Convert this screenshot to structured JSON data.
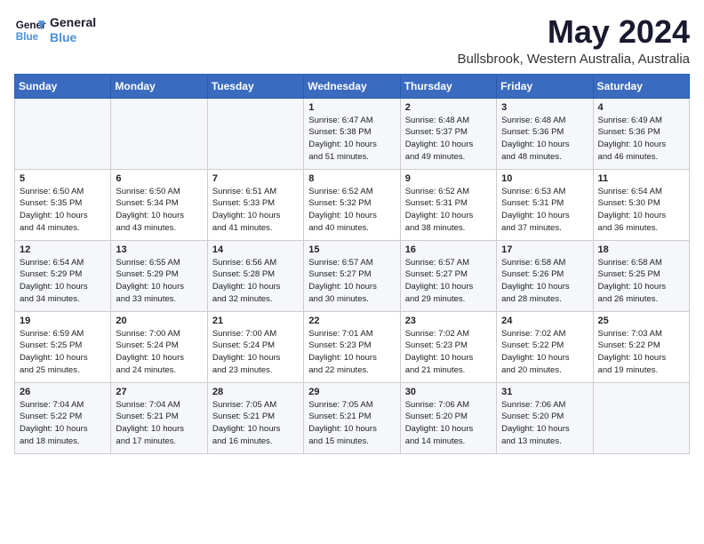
{
  "logo": {
    "line1": "General",
    "line2": "Blue"
  },
  "title": "May 2024",
  "location": "Bullsbrook, Western Australia, Australia",
  "days_header": [
    "Sunday",
    "Monday",
    "Tuesday",
    "Wednesday",
    "Thursday",
    "Friday",
    "Saturday"
  ],
  "weeks": [
    [
      {
        "day": "",
        "info": ""
      },
      {
        "day": "",
        "info": ""
      },
      {
        "day": "",
        "info": ""
      },
      {
        "day": "1",
        "info": "Sunrise: 6:47 AM\nSunset: 5:38 PM\nDaylight: 10 hours\nand 51 minutes."
      },
      {
        "day": "2",
        "info": "Sunrise: 6:48 AM\nSunset: 5:37 PM\nDaylight: 10 hours\nand 49 minutes."
      },
      {
        "day": "3",
        "info": "Sunrise: 6:48 AM\nSunset: 5:36 PM\nDaylight: 10 hours\nand 48 minutes."
      },
      {
        "day": "4",
        "info": "Sunrise: 6:49 AM\nSunset: 5:36 PM\nDaylight: 10 hours\nand 46 minutes."
      }
    ],
    [
      {
        "day": "5",
        "info": "Sunrise: 6:50 AM\nSunset: 5:35 PM\nDaylight: 10 hours\nand 44 minutes."
      },
      {
        "day": "6",
        "info": "Sunrise: 6:50 AM\nSunset: 5:34 PM\nDaylight: 10 hours\nand 43 minutes."
      },
      {
        "day": "7",
        "info": "Sunrise: 6:51 AM\nSunset: 5:33 PM\nDaylight: 10 hours\nand 41 minutes."
      },
      {
        "day": "8",
        "info": "Sunrise: 6:52 AM\nSunset: 5:32 PM\nDaylight: 10 hours\nand 40 minutes."
      },
      {
        "day": "9",
        "info": "Sunrise: 6:52 AM\nSunset: 5:31 PM\nDaylight: 10 hours\nand 38 minutes."
      },
      {
        "day": "10",
        "info": "Sunrise: 6:53 AM\nSunset: 5:31 PM\nDaylight: 10 hours\nand 37 minutes."
      },
      {
        "day": "11",
        "info": "Sunrise: 6:54 AM\nSunset: 5:30 PM\nDaylight: 10 hours\nand 36 minutes."
      }
    ],
    [
      {
        "day": "12",
        "info": "Sunrise: 6:54 AM\nSunset: 5:29 PM\nDaylight: 10 hours\nand 34 minutes."
      },
      {
        "day": "13",
        "info": "Sunrise: 6:55 AM\nSunset: 5:29 PM\nDaylight: 10 hours\nand 33 minutes."
      },
      {
        "day": "14",
        "info": "Sunrise: 6:56 AM\nSunset: 5:28 PM\nDaylight: 10 hours\nand 32 minutes."
      },
      {
        "day": "15",
        "info": "Sunrise: 6:57 AM\nSunset: 5:27 PM\nDaylight: 10 hours\nand 30 minutes."
      },
      {
        "day": "16",
        "info": "Sunrise: 6:57 AM\nSunset: 5:27 PM\nDaylight: 10 hours\nand 29 minutes."
      },
      {
        "day": "17",
        "info": "Sunrise: 6:58 AM\nSunset: 5:26 PM\nDaylight: 10 hours\nand 28 minutes."
      },
      {
        "day": "18",
        "info": "Sunrise: 6:58 AM\nSunset: 5:25 PM\nDaylight: 10 hours\nand 26 minutes."
      }
    ],
    [
      {
        "day": "19",
        "info": "Sunrise: 6:59 AM\nSunset: 5:25 PM\nDaylight: 10 hours\nand 25 minutes."
      },
      {
        "day": "20",
        "info": "Sunrise: 7:00 AM\nSunset: 5:24 PM\nDaylight: 10 hours\nand 24 minutes."
      },
      {
        "day": "21",
        "info": "Sunrise: 7:00 AM\nSunset: 5:24 PM\nDaylight: 10 hours\nand 23 minutes."
      },
      {
        "day": "22",
        "info": "Sunrise: 7:01 AM\nSunset: 5:23 PM\nDaylight: 10 hours\nand 22 minutes."
      },
      {
        "day": "23",
        "info": "Sunrise: 7:02 AM\nSunset: 5:23 PM\nDaylight: 10 hours\nand 21 minutes."
      },
      {
        "day": "24",
        "info": "Sunrise: 7:02 AM\nSunset: 5:22 PM\nDaylight: 10 hours\nand 20 minutes."
      },
      {
        "day": "25",
        "info": "Sunrise: 7:03 AM\nSunset: 5:22 PM\nDaylight: 10 hours\nand 19 minutes."
      }
    ],
    [
      {
        "day": "26",
        "info": "Sunrise: 7:04 AM\nSunset: 5:22 PM\nDaylight: 10 hours\nand 18 minutes."
      },
      {
        "day": "27",
        "info": "Sunrise: 7:04 AM\nSunset: 5:21 PM\nDaylight: 10 hours\nand 17 minutes."
      },
      {
        "day": "28",
        "info": "Sunrise: 7:05 AM\nSunset: 5:21 PM\nDaylight: 10 hours\nand 16 minutes."
      },
      {
        "day": "29",
        "info": "Sunrise: 7:05 AM\nSunset: 5:21 PM\nDaylight: 10 hours\nand 15 minutes."
      },
      {
        "day": "30",
        "info": "Sunrise: 7:06 AM\nSunset: 5:20 PM\nDaylight: 10 hours\nand 14 minutes."
      },
      {
        "day": "31",
        "info": "Sunrise: 7:06 AM\nSunset: 5:20 PM\nDaylight: 10 hours\nand 13 minutes."
      },
      {
        "day": "",
        "info": ""
      }
    ]
  ]
}
